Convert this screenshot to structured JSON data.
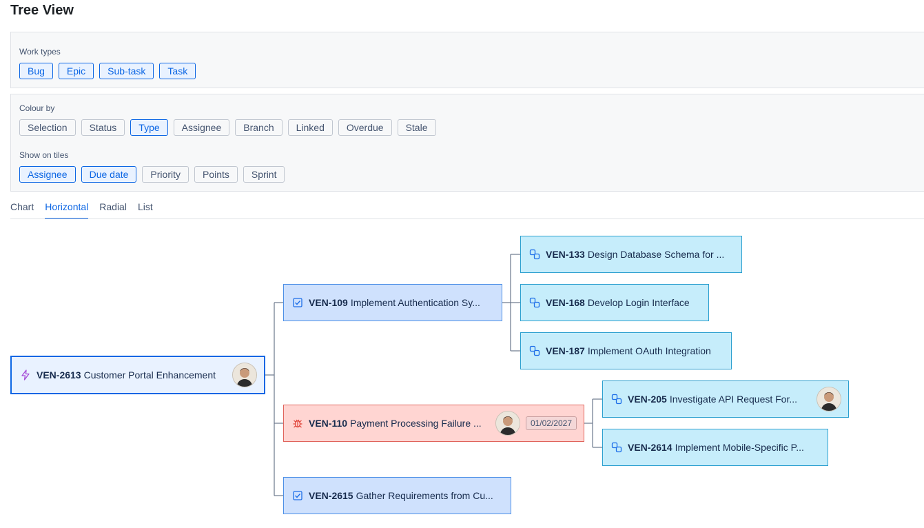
{
  "page": {
    "title": "Tree View"
  },
  "filters": {
    "work_types": {
      "label": "Work types",
      "options": [
        "Bug",
        "Epic",
        "Sub-task",
        "Task"
      ]
    },
    "colour_by": {
      "label": "Colour by",
      "options": [
        "Selection",
        "Status",
        "Type",
        "Assignee",
        "Branch",
        "Linked",
        "Overdue",
        "Stale"
      ],
      "selected": "Type"
    },
    "show_on_tiles": {
      "label": "Show on tiles",
      "options": [
        "Assignee",
        "Due date",
        "Priority",
        "Points",
        "Sprint"
      ],
      "selected": [
        "Assignee",
        "Due date"
      ]
    }
  },
  "view_tabs": {
    "items": [
      "Chart",
      "Horizontal",
      "Radial",
      "List"
    ],
    "selected": "Horizontal"
  },
  "tree": {
    "nodes": [
      {
        "id": "n1",
        "key": "VEN-2613",
        "summary": "Customer Portal Enhancement",
        "type": "epic",
        "icon": "epic-lightning-icon",
        "assignee": true,
        "due": ""
      },
      {
        "id": "n2",
        "key": "VEN-109",
        "summary": "Implement Authentication Sy...",
        "type": "task",
        "icon": "task-checkbox-icon",
        "assignee": false,
        "due": ""
      },
      {
        "id": "n3",
        "key": "VEN-110",
        "summary": "Payment Processing Failure ...",
        "type": "bug",
        "icon": "bug-icon",
        "assignee": true,
        "due": "01/02/2027"
      },
      {
        "id": "n4",
        "key": "VEN-2615",
        "summary": "Gather Requirements from Cu...",
        "type": "task",
        "icon": "task-checkbox-icon",
        "assignee": false,
        "due": ""
      },
      {
        "id": "n5",
        "key": "VEN-133",
        "summary": "Design Database Schema for ...",
        "type": "sub",
        "icon": "subtask-icon",
        "assignee": false,
        "due": ""
      },
      {
        "id": "n6",
        "key": "VEN-168",
        "summary": "Develop Login Interface",
        "type": "sub",
        "icon": "subtask-icon",
        "assignee": false,
        "due": ""
      },
      {
        "id": "n7",
        "key": "VEN-187",
        "summary": "Implement OAuth Integration",
        "type": "sub",
        "icon": "subtask-icon",
        "assignee": false,
        "due": ""
      },
      {
        "id": "n8",
        "key": "VEN-205",
        "summary": "Investigate API Request For...",
        "type": "sub",
        "icon": "subtask-icon",
        "assignee": true,
        "due": ""
      },
      {
        "id": "n9",
        "key": "VEN-2614",
        "summary": "Implement Mobile-Specific P...",
        "type": "sub",
        "icon": "subtask-icon",
        "assignee": false,
        "due": ""
      }
    ]
  }
}
